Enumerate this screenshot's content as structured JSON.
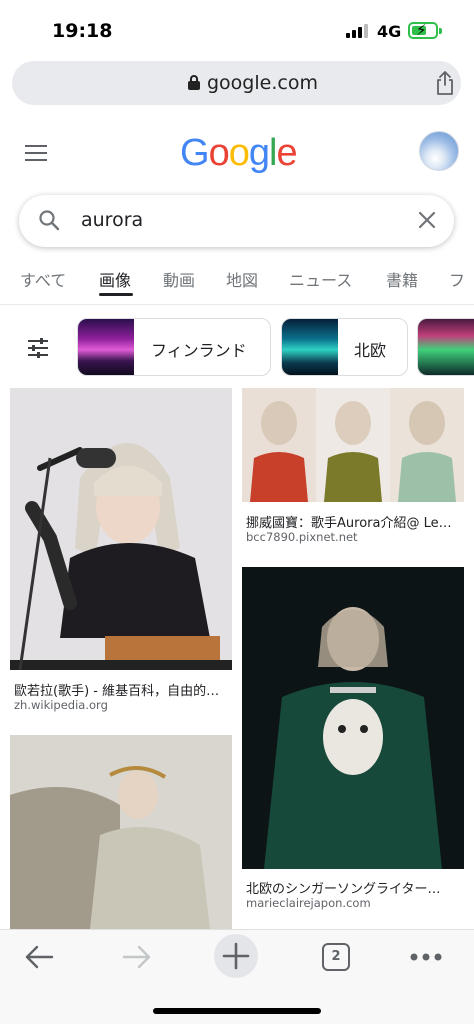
{
  "status": {
    "time": "19:18",
    "network": "4G"
  },
  "browser": {
    "url": "google.com"
  },
  "header": {
    "logo_letters": [
      "G",
      "o",
      "o",
      "g",
      "l",
      "e"
    ],
    "logo_colors": [
      "#4285F4",
      "#EA4335",
      "#FBBC05",
      "#4285F4",
      "#34A853",
      "#EA4335"
    ]
  },
  "search": {
    "query": "aurora"
  },
  "tabs": [
    {
      "label": "すべて"
    },
    {
      "label": "画像"
    },
    {
      "label": "動画"
    },
    {
      "label": "地図"
    },
    {
      "label": "ニュース"
    },
    {
      "label": "書籍"
    },
    {
      "label": "フ"
    }
  ],
  "chips": [
    {
      "label": "フィンランド"
    },
    {
      "label": "北欧"
    }
  ],
  "results": [
    {
      "title": "歐若拉(歌手) - 維基百科，自由的…",
      "source": "zh.wikipedia.org"
    },
    {
      "title": "挪威國寶：歌手Aurora介紹@ Le…",
      "source": "bcc7890.pixnet.net"
    },
    {
      "title": "北欧のシンガーソングライター…",
      "source": "marieclairejapon.com"
    }
  ],
  "toolbar": {
    "tab_count": "2"
  }
}
